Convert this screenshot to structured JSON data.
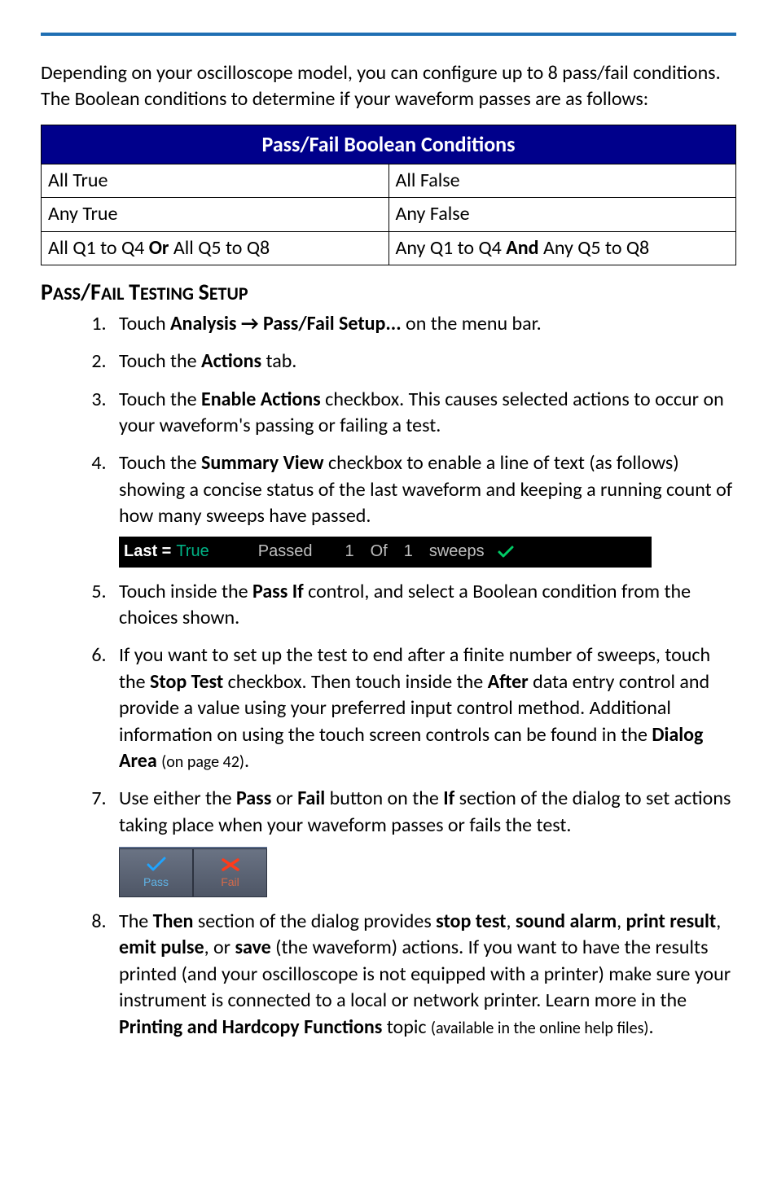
{
  "intro": "Depending on your oscilloscope model, you can configure up to 8 pass/fail conditions. The Boolean conditions to determine if your waveform passes are as follows:",
  "table": {
    "header": "Pass/Fail Boolean Conditions",
    "rows": [
      {
        "left": "All True",
        "right": "All False"
      },
      {
        "left": "Any True",
        "right": "Any False"
      },
      {
        "left_pre": "All Q1 to Q4 ",
        "left_b": "Or",
        "left_post": " All Q5 to Q8",
        "right_pre": "Any Q1 to Q4 ",
        "right_b": "And",
        "right_post": " Any Q5 to Q8"
      }
    ]
  },
  "heading": "Pass/Fail Testing Setup",
  "steps": {
    "s1": {
      "pre": "Touch ",
      "b": "Analysis → Pass/Fail Setup...",
      "post": " on the menu bar."
    },
    "s2": {
      "pre": "Touch the ",
      "b": "Actions",
      "post": " tab."
    },
    "s3": {
      "pre": "Touch the ",
      "b": "Enable Actions",
      "post": " checkbox. This causes selected actions to occur on your waveform's passing or failing a test."
    },
    "s4": {
      "pre": "Touch the ",
      "b": "Summary View",
      "post": " checkbox to enable a line of text (as follows) showing a concise status of the last waveform and keeping a running count of how many sweeps have passed."
    },
    "s5": {
      "pre": "Touch inside the ",
      "b": "Pass If",
      "post": " control, and select a Boolean condition from the choices shown."
    },
    "s6": {
      "pre": "If you want to set up the test to end after a finite number of sweeps, touch the ",
      "b1": "Stop Test",
      "mid1": " checkbox. Then touch inside the ",
      "b2": "After",
      "mid2": " data entry control and provide a value using your preferred input control method. Additional information on using the touch screen controls can be found in the ",
      "b3": "Dialog Area",
      "post": " ",
      "small": "(on page 42)",
      "end": "."
    },
    "s7": {
      "pre": "Use either the ",
      "b1": "Pass",
      "mid1": " or ",
      "b2": "Fail",
      "mid2": " button on the ",
      "b3": "If",
      "post": " section of the dialog to set actions taking place when your waveform passes or fails the test."
    },
    "s8": {
      "pre": "The ",
      "b1": "Then",
      "mid1": " section of the dialog provides ",
      "b2": "stop test",
      "c1": ", ",
      "b3": "sound alarm",
      "c2": ", ",
      "b4": "print result",
      "c3": ", ",
      "b5": "emit pulse",
      "c4": ", or ",
      "b6": "save",
      "mid2": " (the waveform) actions. If you want to have the results printed (and your oscilloscope is not equipped with a printer) make sure your instrument is connected to a local or network printer. Learn more in the ",
      "b7": "Printing and Hardcopy Functions",
      "post": " topic ",
      "small": "(available in the online help files)",
      "end": "."
    }
  },
  "summary": {
    "label": "Last =",
    "true": "True",
    "passed": "Passed",
    "n1": "1",
    "of": "Of",
    "n2": "1",
    "sweeps": "sweeps"
  },
  "pf": {
    "pass": "Pass",
    "fail": "Fail"
  }
}
